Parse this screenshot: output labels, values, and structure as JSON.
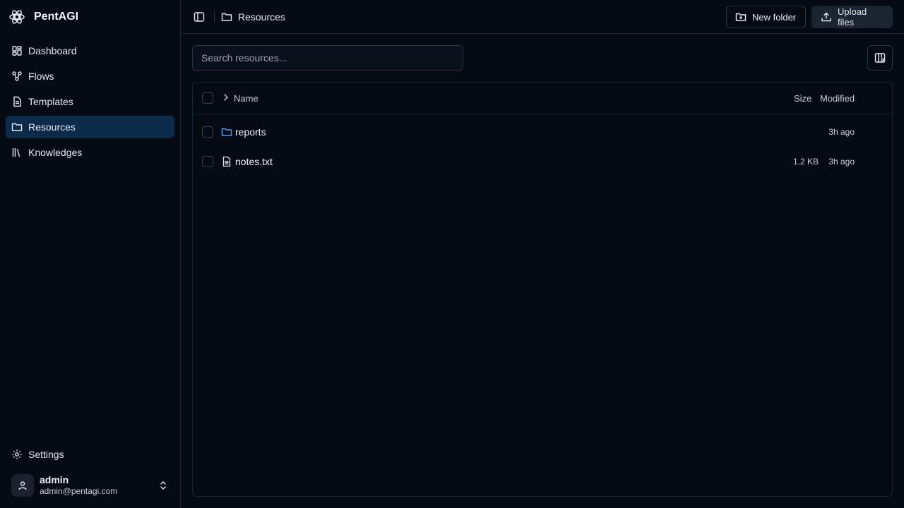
{
  "app": {
    "name": "PentAGI"
  },
  "sidebar": {
    "items": [
      {
        "label": "Dashboard",
        "icon": "dashboard-icon",
        "active": false
      },
      {
        "label": "Flows",
        "icon": "flows-icon",
        "active": false
      },
      {
        "label": "Templates",
        "icon": "templates-icon",
        "active": false
      },
      {
        "label": "Resources",
        "icon": "folder-icon",
        "active": true
      },
      {
        "label": "Knowledges",
        "icon": "library-icon",
        "active": false
      }
    ],
    "settings_label": "Settings",
    "user": {
      "name": "admin",
      "email": "admin@pentagi.com"
    }
  },
  "header": {
    "breadcrumb": "Resources",
    "new_folder_label": "New folder",
    "upload_label": "Upload files"
  },
  "search": {
    "placeholder": "Search resources...",
    "value": ""
  },
  "table": {
    "columns": {
      "name": "Name",
      "size": "Size",
      "modified": "Modified"
    },
    "rows": [
      {
        "type": "folder",
        "name": "reports",
        "size": "",
        "modified": "3h ago"
      },
      {
        "type": "file",
        "name": "notes.txt",
        "size": "1.2 KB",
        "modified": "3h ago"
      }
    ]
  },
  "colors": {
    "accent": "#0c2a4a",
    "folder_icon": "#4d9cf5",
    "background": "#060b13"
  }
}
